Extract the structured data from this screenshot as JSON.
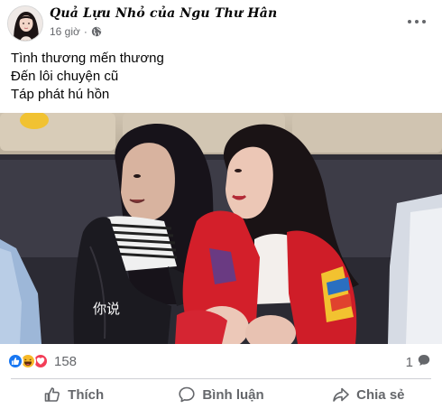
{
  "post": {
    "author": "Quả Lựu Nhỏ của Ngu Thư Hân",
    "time": "16 giờ",
    "separator": "·",
    "privacy_icon": "globe-icon",
    "menu_icon": "more-horizontal-icon"
  },
  "caption": {
    "lines": [
      "Tình thương mến thương",
      "Đến lôi chuyện cũ",
      "Táp phát hú hồn"
    ]
  },
  "media": {
    "subtitle": "你说"
  },
  "stats": {
    "reaction_icons": [
      "like-icon",
      "haha-icon",
      "love-icon"
    ],
    "reaction_count": "158",
    "comment_count": "1",
    "comment_icon": "comment-bubble-icon"
  },
  "actions": {
    "like": "Thích",
    "comment": "Bình luận",
    "share": "Chia sẻ"
  },
  "colors": {
    "like_blue": "#1877f2",
    "haha_yellow": "#f7b928",
    "love_red": "#f33e58",
    "secondary_text": "#65676b"
  }
}
